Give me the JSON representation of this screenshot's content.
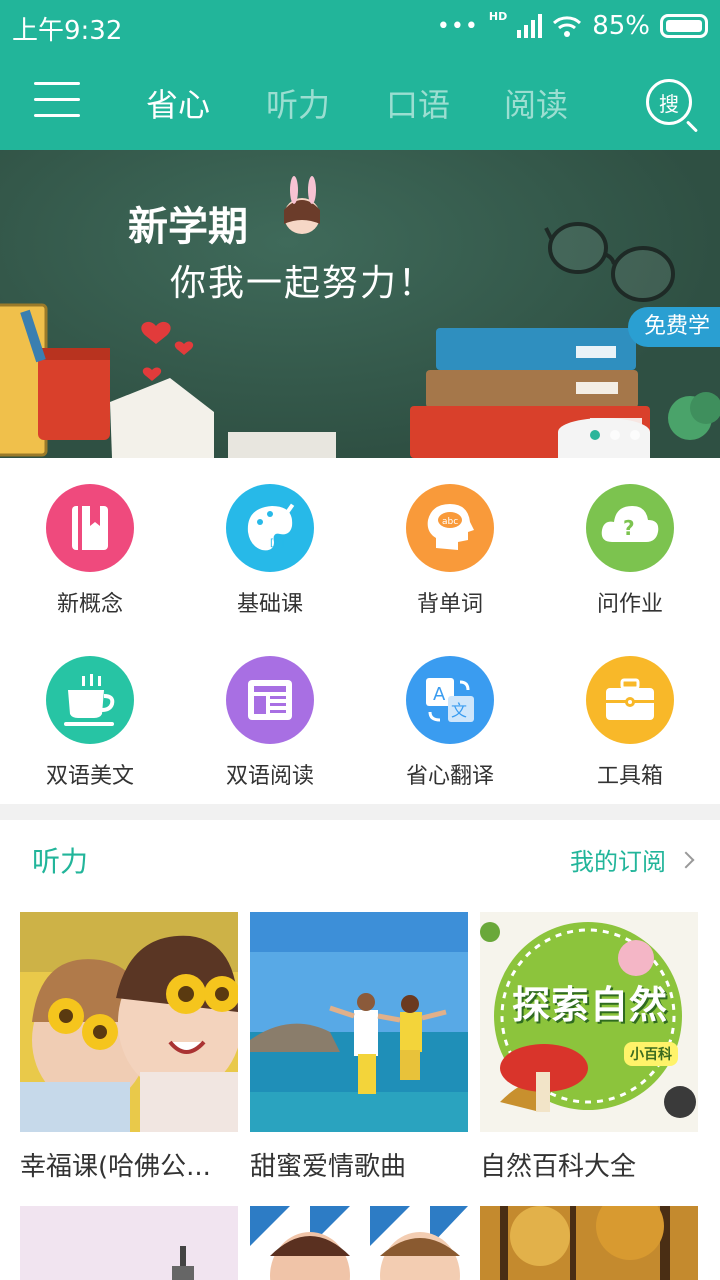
{
  "status": {
    "time": "上午9:32",
    "battery": "85%",
    "network": "HD"
  },
  "nav": {
    "tabs": [
      {
        "label": "省心",
        "active": true
      },
      {
        "label": "听力",
        "active": false
      },
      {
        "label": "口语",
        "active": false
      },
      {
        "label": "阅读",
        "active": false
      }
    ],
    "search_label": "搜"
  },
  "banner": {
    "title": "新学期",
    "subtitle": "你我一起努力！",
    "badge": "免费学"
  },
  "grid": [
    {
      "label": "新概念",
      "color": "#ef4a7d",
      "icon": "book-icon"
    },
    {
      "label": "基础课",
      "color": "#27b9e8",
      "icon": "palette-phonetic-icon"
    },
    {
      "label": "背单词",
      "color": "#f99a3a",
      "icon": "head-abc-icon"
    },
    {
      "label": "问作业",
      "color": "#7cc34f",
      "icon": "question-cloud-icon"
    },
    {
      "label": "双语美文",
      "color": "#27c4a4",
      "icon": "coffee-cup-icon"
    },
    {
      "label": "双语阅读",
      "color": "#a86fe3",
      "icon": "newspaper-icon"
    },
    {
      "label": "省心翻译",
      "color": "#3a9cf0",
      "icon": "translate-icon"
    },
    {
      "label": "工具箱",
      "color": "#f8b829",
      "icon": "toolbox-icon"
    }
  ],
  "listening": {
    "title": "听力",
    "more_label": "我的订阅",
    "cards": [
      {
        "caption": "幸福课(哈佛公..."
      },
      {
        "caption": "甜蜜爱情歌曲"
      },
      {
        "caption": "自然百科大全",
        "cover_title": "探索自然",
        "cover_badge": "小百科"
      }
    ]
  }
}
